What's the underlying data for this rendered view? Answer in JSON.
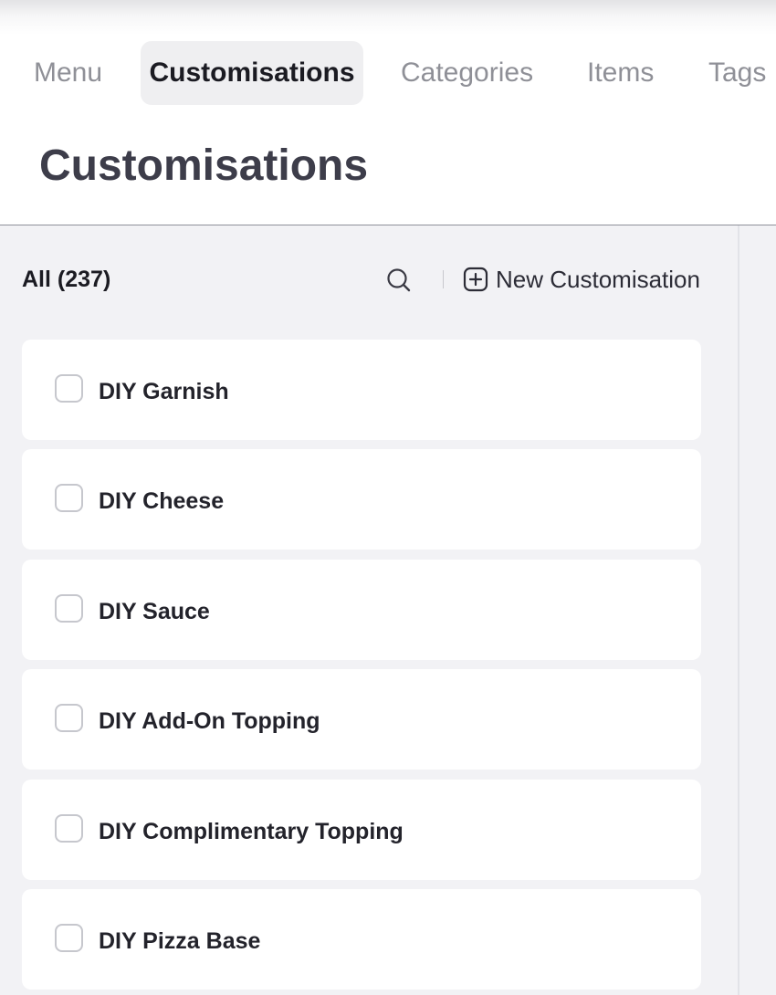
{
  "tabs": [
    {
      "label": "Menu",
      "active": false
    },
    {
      "label": "Customisations",
      "active": true
    },
    {
      "label": "Categories",
      "active": false
    },
    {
      "label": "Items",
      "active": false
    },
    {
      "label": "Tags",
      "active": false
    }
  ],
  "page": {
    "title": "Customisations"
  },
  "toolbar": {
    "filter_label": "All",
    "count": "(237)",
    "search_icon": "search-icon",
    "add_icon": "plus-circle-icon",
    "new_label": "New Customisation"
  },
  "items": [
    {
      "name": "DIY Garnish",
      "checked": false
    },
    {
      "name": "DIY Cheese",
      "checked": false
    },
    {
      "name": "DIY Sauce",
      "checked": false
    },
    {
      "name": "DIY Add-On Topping",
      "checked": false
    },
    {
      "name": "DIY Complimentary Topping",
      "checked": false
    },
    {
      "name": "DIY Pizza Base",
      "checked": false
    }
  ],
  "colors": {
    "active_tab_bg": "#efeff1",
    "inactive_tab_text": "#8f9097",
    "panel_bg": "#f2f2f5",
    "card_bg": "#ffffff",
    "title_text": "#3d3d4a"
  }
}
